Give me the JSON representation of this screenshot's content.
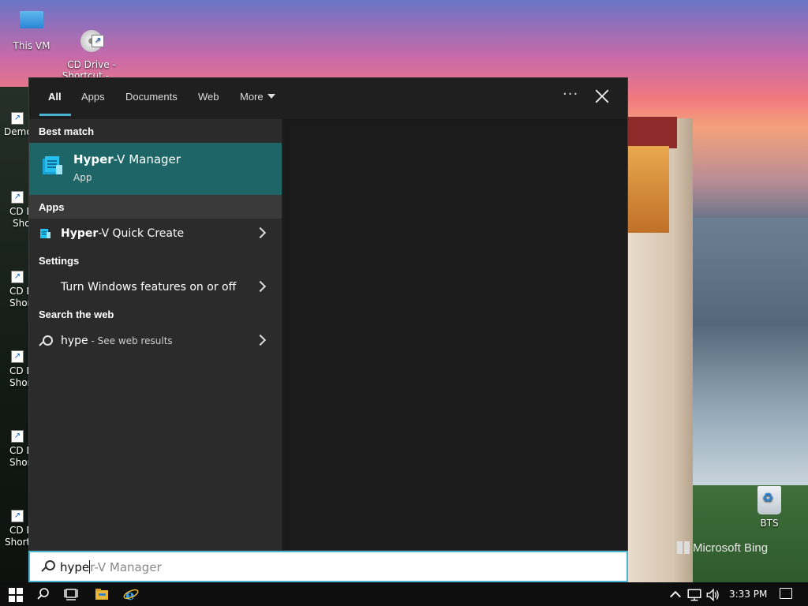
{
  "desktop": {
    "icons": [
      {
        "label": "This VM"
      },
      {
        "label": "CD Drive -\nShortcut - ..."
      },
      {
        "label": "BTS"
      }
    ],
    "partial_labels": [
      "Demo",
      "CD D",
      "Sho",
      "CD D",
      "Shor",
      "CD D",
      "Shor",
      "CD D",
      "Shor",
      "CD D",
      "Shorte"
    ],
    "bing_text": "Microsoft Bing"
  },
  "search_panel": {
    "tabs": [
      {
        "label": "All",
        "active": true
      },
      {
        "label": "Apps"
      },
      {
        "label": "Documents"
      },
      {
        "label": "Web"
      },
      {
        "label": "More"
      }
    ],
    "options_icon": "ellipsis-icon",
    "close_icon": "close-icon",
    "sections": {
      "best_match": "Best match",
      "apps": "Apps",
      "settings": "Settings",
      "web": "Search the web"
    },
    "best_match_item": {
      "title_bold": "Hyper",
      "title_rest": "-V Manager",
      "subtitle": "App",
      "icon": "hyper-v-manager-icon"
    },
    "apps_items": [
      {
        "bold": "Hyper",
        "rest": "-V Quick Create",
        "icon": "hyper-v-quick-create-icon"
      }
    ],
    "settings_items": [
      {
        "label": "Turn Windows features on or off"
      }
    ],
    "web_items": [
      {
        "query": "hype",
        "suffix": " - See web results",
        "icon": "search-icon"
      }
    ]
  },
  "search_box": {
    "typed": "hype",
    "autocomplete": "r-V Manager"
  },
  "taskbar": {
    "clock": "3:33 PM"
  },
  "colors": {
    "accent": "#49b4d3",
    "best_match_bg": "#1d6566",
    "panel_bg": "#1f1f1f"
  }
}
